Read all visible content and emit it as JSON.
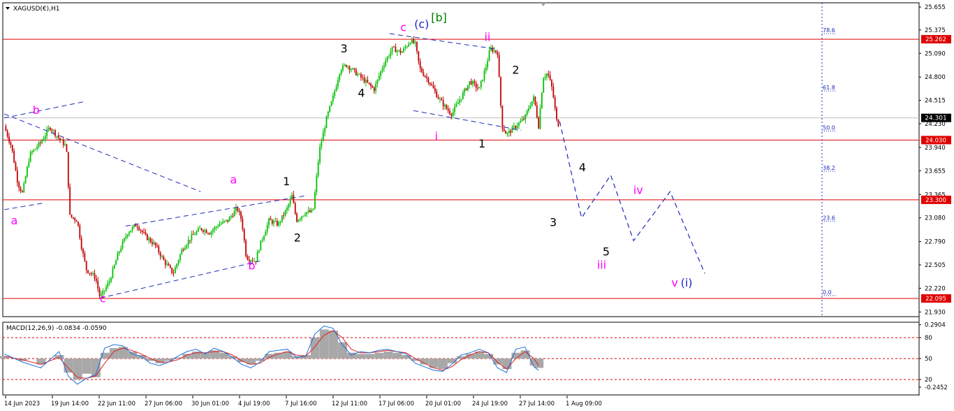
{
  "window": {
    "symbol_title": "XAGUSD(€),H1",
    "menu_icon": "triangle-down-icon"
  },
  "chart_data": [
    {
      "type": "candlestick",
      "symbol": "XAGUSD(€)",
      "timeframe": "H1",
      "ylim": [
        21.89,
        25.69
      ],
      "price_ticks": [
        "25.655",
        "25.375",
        "25.090",
        "24.800",
        "24.515",
        "24.230",
        "23.940",
        "23.655",
        "23.365",
        "23.080",
        "22.790",
        "22.505",
        "22.220",
        "21.930"
      ],
      "x_ticks": [
        "14 Jun 2023",
        "19 Jun 14:00",
        "22 Jun 11:00",
        "27 Jun 06:00",
        "30 Jun 01:00",
        "4 Jul 19:00",
        "7 Jul 16:00",
        "12 Jul 11:00",
        "17 Jul 06:00",
        "20 Jul 01:00",
        "24 Jul 19:00",
        "27 Jul 14:00",
        "1 Aug 09:00"
      ],
      "current_price": "24.301",
      "horizontal_levels": [
        {
          "label": "25.262",
          "value": 25.262,
          "color": "#e00000"
        },
        {
          "label": "24.030",
          "value": 24.03,
          "color": "#e00000"
        },
        {
          "label": "23.300",
          "value": 23.3,
          "color": "#e00000"
        },
        {
          "label": "22.095",
          "value": 22.095,
          "color": "#e00000"
        }
      ],
      "fibonacci_levels": [
        {
          "label": "78.6",
          "value": 25.33
        },
        {
          "label": "61.8",
          "value": 24.63
        },
        {
          "label": "50.0",
          "value": 24.14
        },
        {
          "label": "38.2",
          "value": 23.65
        },
        {
          "label": "23.6",
          "value": 23.04
        },
        {
          "label": "0.0",
          "value": 22.13
        }
      ],
      "price_path": [
        [
          0,
          24.2
        ],
        [
          0.8,
          23.95
        ],
        [
          1.5,
          23.5
        ],
        [
          2.0,
          23.38
        ],
        [
          2.8,
          23.85
        ],
        [
          4.0,
          24.0
        ],
        [
          5.0,
          24.19
        ],
        [
          6.0,
          24.05
        ],
        [
          6.8,
          23.95
        ],
        [
          7.2,
          23.1
        ],
        [
          8.0,
          23.05
        ],
        [
          8.5,
          22.7
        ],
        [
          9.0,
          22.45
        ],
        [
          10.0,
          22.35
        ],
        [
          10.5,
          22.1
        ],
        [
          11.5,
          22.3
        ],
        [
          12.5,
          22.65
        ],
        [
          13.5,
          22.9
        ],
        [
          14.5,
          23.0
        ],
        [
          15.5,
          22.85
        ],
        [
          16.5,
          22.75
        ],
        [
          17.5,
          22.55
        ],
        [
          18.5,
          22.4
        ],
        [
          19.5,
          22.7
        ],
        [
          20.5,
          22.85
        ],
        [
          21.5,
          22.95
        ],
        [
          22.5,
          22.9
        ],
        [
          23.5,
          23.0
        ],
        [
          24.5,
          23.05
        ],
        [
          25.5,
          23.2
        ],
        [
          26.0,
          23.05
        ],
        [
          26.5,
          22.6
        ],
        [
          27.5,
          22.55
        ],
        [
          28.0,
          22.75
        ],
        [
          29.0,
          23.05
        ],
        [
          30.0,
          23.0
        ],
        [
          31.0,
          23.2
        ],
        [
          31.5,
          23.35
        ],
        [
          32.0,
          23.05
        ],
        [
          33.0,
          23.15
        ],
        [
          33.8,
          23.15
        ],
        [
          34.5,
          23.9
        ],
        [
          35.3,
          24.3
        ],
        [
          36.0,
          24.55
        ],
        [
          36.8,
          24.9
        ],
        [
          37.5,
          24.95
        ],
        [
          38.5,
          24.85
        ],
        [
          39.5,
          24.75
        ],
        [
          40.5,
          24.65
        ],
        [
          41.5,
          24.95
        ],
        [
          42.5,
          25.15
        ],
        [
          43.5,
          25.1
        ],
        [
          44.5,
          25.25
        ],
        [
          45.0,
          25.2
        ],
        [
          45.5,
          24.9
        ],
        [
          46.5,
          24.75
        ],
        [
          47.5,
          24.55
        ],
        [
          48.5,
          24.4
        ],
        [
          49.0,
          24.35
        ],
        [
          50.0,
          24.55
        ],
        [
          51.0,
          24.75
        ],
        [
          52.0,
          24.65
        ],
        [
          52.8,
          24.95
        ],
        [
          53.2,
          25.15
        ],
        [
          54.0,
          25.1
        ],
        [
          54.5,
          24.2
        ],
        [
          55.0,
          24.1
        ],
        [
          56.0,
          24.2
        ],
        [
          57.0,
          24.3
        ],
        [
          57.5,
          24.45
        ],
        [
          58.0,
          24.55
        ],
        [
          58.5,
          24.2
        ],
        [
          59.0,
          24.8
        ],
        [
          59.5,
          24.85
        ],
        [
          60.0,
          24.65
        ],
        [
          60.5,
          24.25
        ],
        [
          60.8,
          24.2
        ]
      ],
      "projection_path": [
        [
          60.8,
          24.26
        ],
        [
          63.2,
          23.08
        ],
        [
          66.4,
          23.6
        ],
        [
          68.9,
          22.8
        ],
        [
          72.9,
          23.4
        ],
        [
          76.7,
          22.4
        ]
      ],
      "x_range": [
        0,
        100
      ],
      "channels": [
        {
          "p1": [
            0,
            24.3
          ],
          "p2": [
            8.8,
            24.5
          ]
        },
        {
          "p1": [
            0,
            24.35
          ],
          "p2": [
            21.5,
            23.4
          ]
        },
        {
          "p1": [
            0,
            23.18
          ],
          "p2": [
            4.3,
            23.26
          ]
        },
        {
          "p1": [
            13.3,
            22.98
          ],
          "p2": [
            33.0,
            23.35
          ]
        },
        {
          "p1": [
            10.5,
            22.1
          ],
          "p2": [
            28.3,
            22.56
          ]
        },
        {
          "p1": [
            42.2,
            25.33
          ],
          "p2": [
            54.0,
            25.14
          ]
        },
        {
          "p1": [
            44.8,
            24.39
          ],
          "p2": [
            56.6,
            24.15
          ]
        }
      ],
      "wave_labels": [
        {
          "text": "b",
          "value": 24.35,
          "x": 3.5,
          "color": "#ff00ff"
        },
        {
          "text": "a",
          "value": 23.0,
          "x": 1.1,
          "color": "#ff00ff"
        },
        {
          "text": "c",
          "value": 22.05,
          "x": 10.8,
          "color": "#ff00ff"
        },
        {
          "text": "a",
          "value": 23.5,
          "x": 25.1,
          "color": "#ff00ff"
        },
        {
          "text": "b",
          "value": 22.45,
          "x": 27.1,
          "color": "#ff00ff"
        },
        {
          "text": "1",
          "value": 23.48,
          "x": 30.9,
          "color": "#000000"
        },
        {
          "text": "2",
          "value": 22.79,
          "x": 32.1,
          "color": "#000000"
        },
        {
          "text": "3",
          "value": 25.1,
          "x": 37.2,
          "color": "#000000"
        },
        {
          "text": "4",
          "value": 24.56,
          "x": 39.1,
          "color": "#000000"
        },
        {
          "text": "c",
          "value": 25.36,
          "x": 43.7,
          "color": "#ff00ff"
        },
        {
          "text": "(c)",
          "value": 25.4,
          "x": 45.7,
          "color": "#2222cc"
        },
        {
          "text": "[b]",
          "value": 25.48,
          "x": 47.6,
          "color": "#008000"
        },
        {
          "text": "ii",
          "value": 25.24,
          "x": 52.9,
          "color": "#ff00ff"
        },
        {
          "text": "2",
          "value": 24.84,
          "x": 56.0,
          "color": "#000000"
        },
        {
          "text": "i",
          "value": 24.03,
          "x": 47.3,
          "color": "#ff00ff"
        },
        {
          "text": "1",
          "value": 23.94,
          "x": 52.3,
          "color": "#000000"
        },
        {
          "text": "3",
          "value": 22.98,
          "x": 60.1,
          "color": "#000000"
        },
        {
          "text": "4",
          "value": 23.65,
          "x": 63.3,
          "color": "#000000"
        },
        {
          "text": "iv",
          "value": 23.37,
          "x": 69.4,
          "color": "#ff00ff"
        },
        {
          "text": "5",
          "value": 22.62,
          "x": 65.9,
          "color": "#000000"
        },
        {
          "text": "iii",
          "value": 22.46,
          "x": 65.4,
          "color": "#ff00ff"
        },
        {
          "text": "v",
          "value": 22.24,
          "x": 73.4,
          "color": "#ff00ff"
        },
        {
          "text": "(i)",
          "value": 22.24,
          "x": 74.7,
          "color": "#2222cc"
        }
      ]
    },
    {
      "type": "macd",
      "title": "MACD(12,26,9) -0.0834 -0.0590",
      "ylim": [
        -0.3,
        0.3
      ],
      "ticks": [
        "0.2904",
        "80",
        "50",
        "20",
        "-0.2452"
      ],
      "levels": [
        {
          "label": "80",
          "value": 0.18
        },
        {
          "label": "50",
          "value": 0.0
        },
        {
          "label": "20",
          "value": -0.18
        }
      ],
      "histogram": [
        [
          0,
          0.02
        ],
        [
          2,
          -0.02
        ],
        [
          4,
          -0.05
        ],
        [
          6,
          0.03
        ],
        [
          7,
          -0.12
        ],
        [
          8,
          -0.18
        ],
        [
          9,
          -0.13
        ],
        [
          10,
          -0.16
        ],
        [
          11,
          0.05
        ],
        [
          12,
          0.09
        ],
        [
          13,
          0.1
        ],
        [
          14,
          0.06
        ],
        [
          15,
          0.03
        ],
        [
          16,
          -0.02
        ],
        [
          17,
          -0.04
        ],
        [
          18,
          -0.02
        ],
        [
          19,
          0.01
        ],
        [
          20,
          0.04
        ],
        [
          21,
          0.06
        ],
        [
          22,
          0.05
        ],
        [
          23,
          0.07
        ],
        [
          24,
          0.05
        ],
        [
          25,
          0.02
        ],
        [
          26,
          -0.03
        ],
        [
          27,
          -0.05
        ],
        [
          28,
          -0.02
        ],
        [
          29,
          0.04
        ],
        [
          30,
          0.05
        ],
        [
          31,
          0.06
        ],
        [
          32,
          0.02
        ],
        [
          33,
          0.03
        ],
        [
          34,
          0.18
        ],
        [
          35,
          0.25
        ],
        [
          36,
          0.24
        ],
        [
          37,
          0.14
        ],
        [
          38,
          0.05
        ],
        [
          39,
          0.04
        ],
        [
          40,
          0.04
        ],
        [
          41,
          0.05
        ],
        [
          42,
          0.06
        ],
        [
          43,
          0.05
        ],
        [
          44,
          0.03
        ],
        [
          45,
          -0.02
        ],
        [
          46,
          -0.05
        ],
        [
          47,
          -0.08
        ],
        [
          48,
          -0.09
        ],
        [
          49,
          -0.04
        ],
        [
          50,
          0.02
        ],
        [
          51,
          0.04
        ],
        [
          52,
          0.06
        ],
        [
          53,
          0.04
        ],
        [
          54,
          -0.05
        ],
        [
          55,
          -0.09
        ],
        [
          56,
          0.05
        ],
        [
          57,
          0.07
        ],
        [
          58,
          -0.06
        ],
        [
          58.5,
          -0.08
        ]
      ],
      "macd_line": [
        [
          0,
          0.04
        ],
        [
          2,
          -0.03
        ],
        [
          4,
          -0.08
        ],
        [
          6,
          0.06
        ],
        [
          7,
          -0.15
        ],
        [
          8,
          -0.22
        ],
        [
          9,
          -0.17
        ],
        [
          10,
          -0.14
        ],
        [
          11,
          0.09
        ],
        [
          12,
          0.12
        ],
        [
          13,
          0.11
        ],
        [
          14,
          0.04
        ],
        [
          15,
          0.02
        ],
        [
          16,
          -0.04
        ],
        [
          17,
          -0.06
        ],
        [
          18,
          -0.03
        ],
        [
          19,
          0.02
        ],
        [
          20,
          0.06
        ],
        [
          21,
          0.08
        ],
        [
          22,
          0.04
        ],
        [
          23,
          0.09
        ],
        [
          24,
          0.06
        ],
        [
          25,
          0.01
        ],
        [
          26,
          -0.05
        ],
        [
          27,
          -0.08
        ],
        [
          28,
          -0.03
        ],
        [
          29,
          0.06
        ],
        [
          30,
          0.07
        ],
        [
          31,
          0.08
        ],
        [
          32,
          0.01
        ],
        [
          33,
          0.02
        ],
        [
          34,
          0.21
        ],
        [
          35,
          0.28
        ],
        [
          36,
          0.26
        ],
        [
          37,
          0.12
        ],
        [
          38,
          0.03
        ],
        [
          39,
          0.06
        ],
        [
          40,
          0.05
        ],
        [
          41,
          0.07
        ],
        [
          42,
          0.08
        ],
        [
          43,
          0.06
        ],
        [
          44,
          0.04
        ],
        [
          45,
          -0.04
        ],
        [
          46,
          -0.07
        ],
        [
          47,
          -0.1
        ],
        [
          48,
          -0.11
        ],
        [
          49,
          -0.05
        ],
        [
          50,
          0.03
        ],
        [
          51,
          0.05
        ],
        [
          52,
          0.08
        ],
        [
          53,
          0.05
        ],
        [
          54,
          -0.08
        ],
        [
          55,
          -0.12
        ],
        [
          56,
          0.08
        ],
        [
          57,
          0.1
        ],
        [
          58,
          -0.07
        ],
        [
          58.5,
          -0.1
        ]
      ],
      "signal_line": [
        [
          0,
          0.02
        ],
        [
          2,
          -0.01
        ],
        [
          4,
          -0.05
        ],
        [
          6,
          0.01
        ],
        [
          7,
          -0.08
        ],
        [
          8,
          -0.16
        ],
        [
          9,
          -0.17
        ],
        [
          10,
          -0.15
        ],
        [
          11,
          -0.04
        ],
        [
          12,
          0.06
        ],
        [
          13,
          0.09
        ],
        [
          14,
          0.07
        ],
        [
          15,
          0.04
        ],
        [
          16,
          0.0
        ],
        [
          17,
          -0.03
        ],
        [
          18,
          -0.03
        ],
        [
          19,
          -0.01
        ],
        [
          20,
          0.03
        ],
        [
          21,
          0.05
        ],
        [
          22,
          0.05
        ],
        [
          23,
          0.06
        ],
        [
          24,
          0.06
        ],
        [
          25,
          0.03
        ],
        [
          26,
          -0.02
        ],
        [
          27,
          -0.05
        ],
        [
          28,
          -0.04
        ],
        [
          29,
          0.01
        ],
        [
          30,
          0.04
        ],
        [
          31,
          0.06
        ],
        [
          32,
          0.03
        ],
        [
          33,
          0.02
        ],
        [
          34,
          0.1
        ],
        [
          35,
          0.2
        ],
        [
          36,
          0.24
        ],
        [
          37,
          0.18
        ],
        [
          38,
          0.08
        ],
        [
          39,
          0.05
        ],
        [
          40,
          0.05
        ],
        [
          41,
          0.06
        ],
        [
          42,
          0.07
        ],
        [
          43,
          0.06
        ],
        [
          44,
          0.05
        ],
        [
          45,
          0.0
        ],
        [
          46,
          -0.04
        ],
        [
          47,
          -0.08
        ],
        [
          48,
          -0.1
        ],
        [
          49,
          -0.07
        ],
        [
          50,
          -0.01
        ],
        [
          51,
          0.03
        ],
        [
          52,
          0.06
        ],
        [
          53,
          0.05
        ],
        [
          54,
          -0.03
        ],
        [
          55,
          -0.09
        ],
        [
          56,
          0.0
        ],
        [
          57,
          0.06
        ],
        [
          58,
          0.0
        ],
        [
          58.5,
          -0.06
        ]
      ]
    }
  ],
  "colors": {
    "bull_candle": "#00c000",
    "bear_candle": "#c00000",
    "level_line": "#e00000",
    "level_label_bg": "#e00000",
    "current_price_bg": "#000000",
    "channel": "#1c2bb8",
    "fib": "#1c2bb8",
    "macd_hist": "#a8a8a8",
    "macd_line": "#1e6fd9",
    "signal_line": "#e02020",
    "macd_level": "#e00000"
  }
}
